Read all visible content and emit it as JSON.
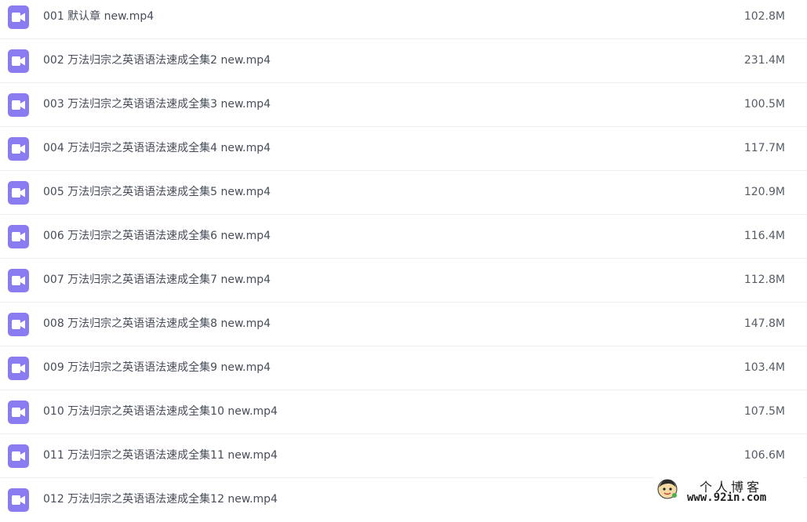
{
  "files": [
    {
      "name": "001 默认章 new.mp4",
      "size": "102.8M",
      "icon": "video-file-icon"
    },
    {
      "name": "002 万法归宗之英语语法速成全集2 new.mp4",
      "size": "231.4M",
      "icon": "video-file-icon"
    },
    {
      "name": "003 万法归宗之英语语法速成全集3 new.mp4",
      "size": "100.5M",
      "icon": "video-file-icon"
    },
    {
      "name": "004 万法归宗之英语语法速成全集4 new.mp4",
      "size": "117.7M",
      "icon": "video-file-icon"
    },
    {
      "name": "005 万法归宗之英语语法速成全集5 new.mp4",
      "size": "120.9M",
      "icon": "video-file-icon"
    },
    {
      "name": "006 万法归宗之英语语法速成全集6 new.mp4",
      "size": "116.4M",
      "icon": "video-file-icon"
    },
    {
      "name": "007 万法归宗之英语语法速成全集7 new.mp4",
      "size": "112.8M",
      "icon": "video-file-icon"
    },
    {
      "name": "008 万法归宗之英语语法速成全集8 new.mp4",
      "size": "147.8M",
      "icon": "video-file-icon"
    },
    {
      "name": "009 万法归宗之英语语法速成全集9 new.mp4",
      "size": "103.4M",
      "icon": "video-file-icon"
    },
    {
      "name": "010 万法归宗之英语语法速成全集10 new.mp4",
      "size": "107.5M",
      "icon": "video-file-icon"
    },
    {
      "name": "011 万法归宗之英语语法速成全集11 new.mp4",
      "size": "106.6M",
      "icon": "video-file-icon"
    },
    {
      "name": "012 万法归宗之英语语法速成全集12 new.mp4",
      "size": "",
      "icon": "video-file-icon"
    }
  ],
  "watermark": {
    "title": "个人博客",
    "url": "www.92in.com"
  },
  "colors": {
    "icon_bg": "#8a7cf0",
    "text": "#454d5a",
    "divider": "#eef0f3"
  }
}
